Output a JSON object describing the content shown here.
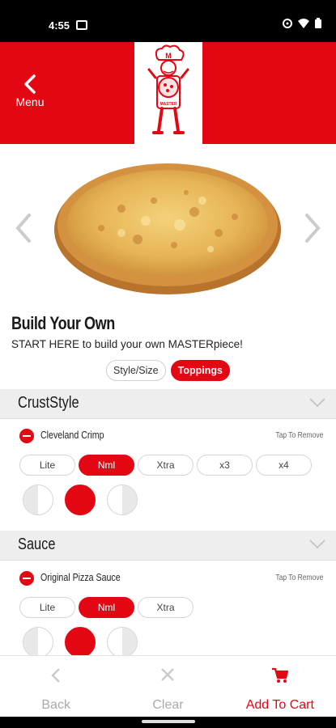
{
  "status": {
    "time": "4:55"
  },
  "header": {
    "back_label": "Menu",
    "logo_letter": "M",
    "logo_text": "MASTER"
  },
  "product": {
    "title": "Build Your Own",
    "subtitle": "START HERE to build your own MASTERpiece!"
  },
  "tabs": [
    {
      "label": "Style/Size",
      "active": false
    },
    {
      "label": "Toppings",
      "active": true
    }
  ],
  "sections": [
    {
      "title": "CrustStyle",
      "topping": "Cleveland Crimp",
      "tap_remove": "Tap To Remove",
      "amounts": [
        "Lite",
        "Nml",
        "Xtra",
        "x3",
        "x4"
      ],
      "selected_amount": "Nml"
    },
    {
      "title": "Sauce",
      "topping": "Original Pizza Sauce",
      "tap_remove": "Tap To Remove",
      "amounts": [
        "Lite",
        "Nml",
        "Xtra"
      ],
      "selected_amount": "Nml"
    }
  ],
  "bottom_bar": {
    "back": "Back",
    "clear": "Clear",
    "add_to_cart": "Add To Cart"
  },
  "colors": {
    "brand_red": "#e30613",
    "section_gray": "#eeeeee"
  },
  "icons": {
    "back": "chevron-left-icon",
    "carousel_prev": "chevron-left-icon",
    "carousel_next": "chevron-right-icon",
    "collapse": "chevron-down-icon",
    "clear": "close-icon",
    "cart": "shopping-cart-icon"
  }
}
